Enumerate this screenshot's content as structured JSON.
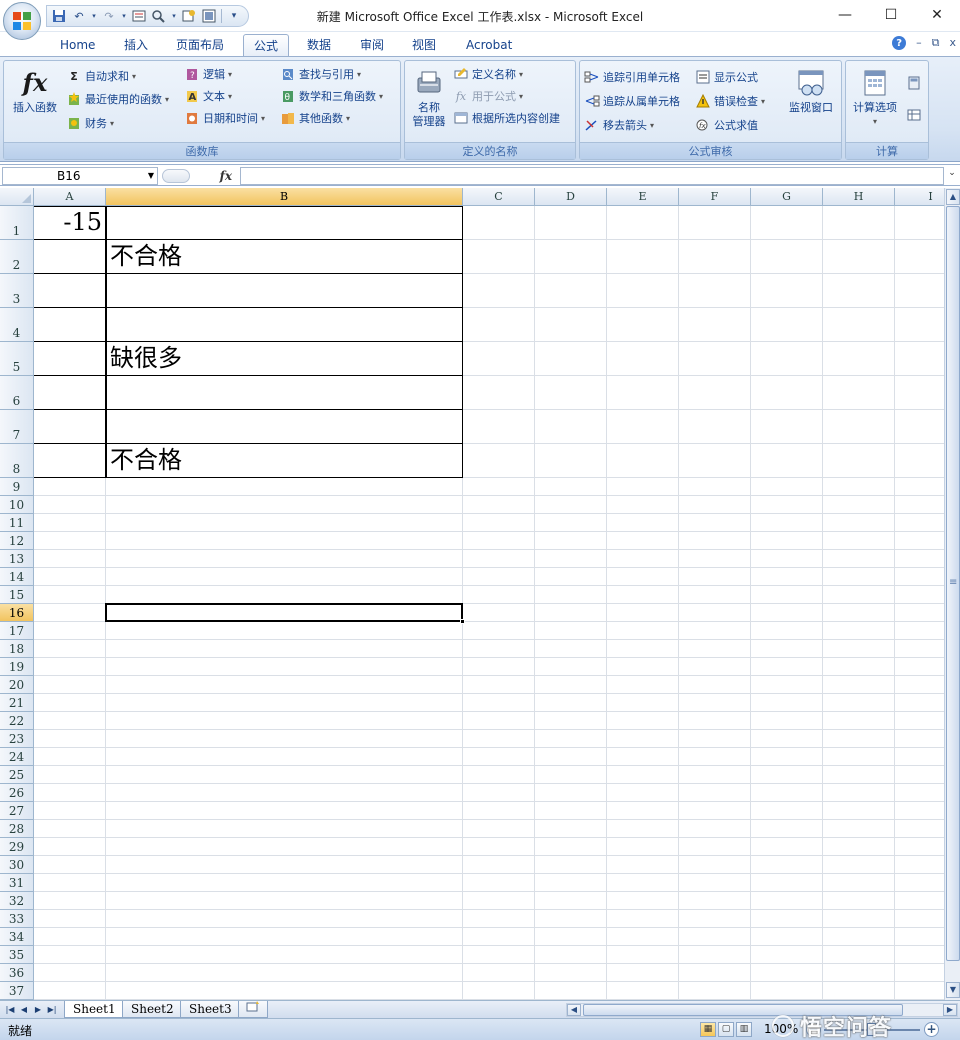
{
  "window": {
    "title": "新建 Microsoft Office Excel 工作表.xlsx - Microsoft Excel",
    "minimize": "—",
    "maximize": "☐",
    "close": "✕"
  },
  "tabs": [
    {
      "label": "Home",
      "active": false
    },
    {
      "label": "插入",
      "active": false
    },
    {
      "label": "页面布局",
      "active": false
    },
    {
      "label": "公式",
      "active": true
    },
    {
      "label": "数据",
      "active": false
    },
    {
      "label": "审阅",
      "active": false
    },
    {
      "label": "视图",
      "active": false
    },
    {
      "label": "Acrobat",
      "active": false
    }
  ],
  "ribbon_ctrls": {
    "help": "?",
    "min": "–",
    "restore": "⧉",
    "close": "x"
  },
  "ribbon": {
    "function_library": {
      "label": "函数库",
      "insert_function": "插入函数",
      "autosum": "自动求和",
      "recently_used": "最近使用的函数",
      "financial": "财务",
      "logical": "逻辑",
      "text": "文本",
      "date_time": "日期和时间",
      "lookup_reference": "查找与引用",
      "math_trig": "数学和三角函数",
      "more_functions": "其他函数"
    },
    "defined_names": {
      "label": "定义的名称",
      "name_manager": "名称\n管理器",
      "define_name": "定义名称",
      "use_in_formula": "用于公式",
      "create_from_selection": "根据所选内容创建"
    },
    "formula_auditing": {
      "label": "公式审核",
      "trace_precedents": "追踪引用单元格",
      "trace_dependents": "追踪从属单元格",
      "remove_arrows": "移去箭头",
      "show_formulas": "显示公式",
      "error_checking": "错误检查",
      "evaluate_formula": "公式求值",
      "watch_window": "监视窗口"
    },
    "calculation": {
      "label": "计算",
      "calc_options": "计算选项"
    }
  },
  "formula_bar": {
    "name_box": "B16",
    "fx": "fx",
    "formula": ""
  },
  "columns": [
    "A",
    "B",
    "C",
    "D",
    "E",
    "F",
    "G",
    "H",
    "I"
  ],
  "selected_column": "B",
  "rows": [
    "1",
    "2",
    "3",
    "4",
    "5",
    "6",
    "7",
    "8",
    "9",
    "10",
    "11",
    "12",
    "13",
    "14",
    "15",
    "16",
    "17",
    "18",
    "19",
    "20",
    "21",
    "22",
    "23",
    "24",
    "25",
    "26",
    "27",
    "28",
    "29",
    "30",
    "31",
    "32",
    "33",
    "34",
    "35",
    "36",
    "37"
  ],
  "selected_row": "16",
  "cells": {
    "A1": "-15",
    "B2": "不合格",
    "B5": "缺很多",
    "B8": "不合格"
  },
  "sheets": [
    {
      "label": "Sheet1",
      "active": true
    },
    {
      "label": "Sheet2",
      "active": false
    },
    {
      "label": "Sheet3",
      "active": false
    }
  ],
  "status": {
    "mode": "就绪",
    "zoom": "100%"
  },
  "watermark": "悟空问答",
  "colors": {
    "accent": "#15428b",
    "ribbon": "#d6e3f3",
    "selected_header": "#f2c45f"
  }
}
